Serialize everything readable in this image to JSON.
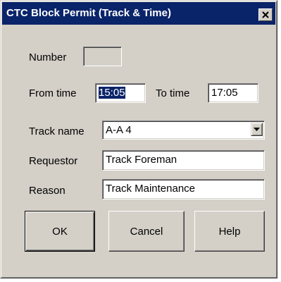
{
  "window": {
    "title": "CTC Block Permit (Track & Time)"
  },
  "form": {
    "number_label": "Number",
    "number_value": "",
    "from_time_label": "From time",
    "from_time_value": "15:05",
    "to_time_label": "To time",
    "to_time_value": "17:05",
    "track_name_label": "Track name",
    "track_name_value": "A-A 4",
    "requestor_label": "Requestor",
    "requestor_value": "Track Foreman",
    "reason_label": "Reason",
    "reason_value": "Track Maintenance"
  },
  "buttons": {
    "ok": "OK",
    "cancel": "Cancel",
    "help": "Help"
  },
  "colors": {
    "titlebar": "#0a246a",
    "face": "#d4d0c8",
    "selection": "#0a246a"
  },
  "icons": {
    "close": "close-icon",
    "dropdown": "chevron-down-icon"
  }
}
